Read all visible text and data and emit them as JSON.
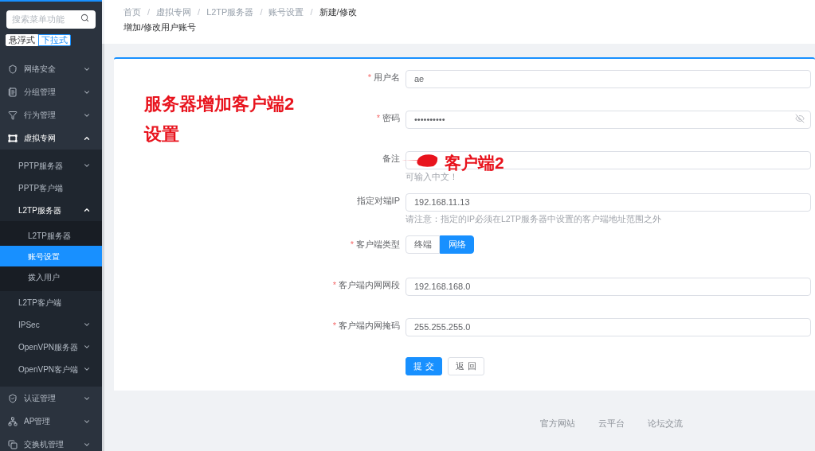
{
  "sidebar": {
    "search": {
      "placeholder": "搜索菜单功能"
    },
    "mode_toggle": [
      {
        "label": "悬浮式",
        "selected": false
      },
      {
        "label": "下拉式",
        "selected": true
      }
    ],
    "menu": [
      {
        "label": "网络安全",
        "expanded": false
      },
      {
        "label": "分组管理",
        "expanded": false
      },
      {
        "label": "行为管理",
        "expanded": false
      },
      {
        "label": "虚拟专网",
        "expanded": true,
        "children": [
          {
            "label": "PPTP服务器",
            "expanded": false
          },
          {
            "label": "PPTP客户端",
            "selected": false
          },
          {
            "label": "L2TP服务器",
            "expanded": true,
            "children": [
              {
                "label": "L2TP服务器",
                "selected": false
              },
              {
                "label": "账号设置",
                "selected": true
              },
              {
                "label": "拨入用户",
                "selected": false
              }
            ]
          },
          {
            "label": "L2TP客户端",
            "selected": false
          },
          {
            "label": "IPSec",
            "expanded": false
          },
          {
            "label": "OpenVPN服务器",
            "expanded": false
          },
          {
            "label": "OpenVPN客户端",
            "expanded": false
          }
        ]
      },
      {
        "label": "认证管理",
        "expanded": false
      },
      {
        "label": "AP管理",
        "expanded": false
      },
      {
        "label": "交换机管理",
        "expanded": false
      }
    ]
  },
  "header": {
    "breadcrumb": {
      "separator": "/",
      "items": [
        {
          "label": "首页",
          "current": false
        },
        {
          "label": "虚拟专网",
          "current": false
        },
        {
          "label": "L2TP服务器",
          "current": false
        },
        {
          "label": "账号设置",
          "current": false
        },
        {
          "label": "新建/修改",
          "current": true
        }
      ]
    },
    "title": "增加/修改用户账号"
  },
  "annotation": {
    "text": "服务器增加客户端2设置"
  },
  "form": {
    "required_mark": "*",
    "fields": [
      {
        "kind": "input",
        "label": "用户名",
        "required": true,
        "value": "ae"
      },
      {
        "kind": "password",
        "label": "密码",
        "required": true,
        "value": "••••••••••"
      },
      {
        "kind": "input",
        "label": "备注",
        "required": false,
        "hint": "可输入中文！",
        "annotation": "客户端2"
      },
      {
        "kind": "input",
        "label": "指定对端IP",
        "required": false,
        "value": "192.168.11.13",
        "hint": "请注意：指定的IP必须在L2TP服务器中设置的客户端地址范围之外"
      },
      {
        "kind": "radio",
        "label": "客户端类型",
        "required": true,
        "options": [
          {
            "label": "终端",
            "selected": false
          },
          {
            "label": "网络",
            "selected": true
          }
        ]
      },
      {
        "kind": "input",
        "label": "客户端内网网段",
        "required": true,
        "value": "192.168.168.0"
      },
      {
        "kind": "input",
        "label": "客户端内网掩码",
        "required": true,
        "value": "255.255.255.0"
      }
    ],
    "buttons": [
      {
        "label": "提 交",
        "kind": "primary"
      },
      {
        "label": "返 回",
        "kind": "default"
      }
    ]
  },
  "footer": {
    "links": [
      "官方网站",
      "云平台",
      "论坛交流"
    ]
  }
}
